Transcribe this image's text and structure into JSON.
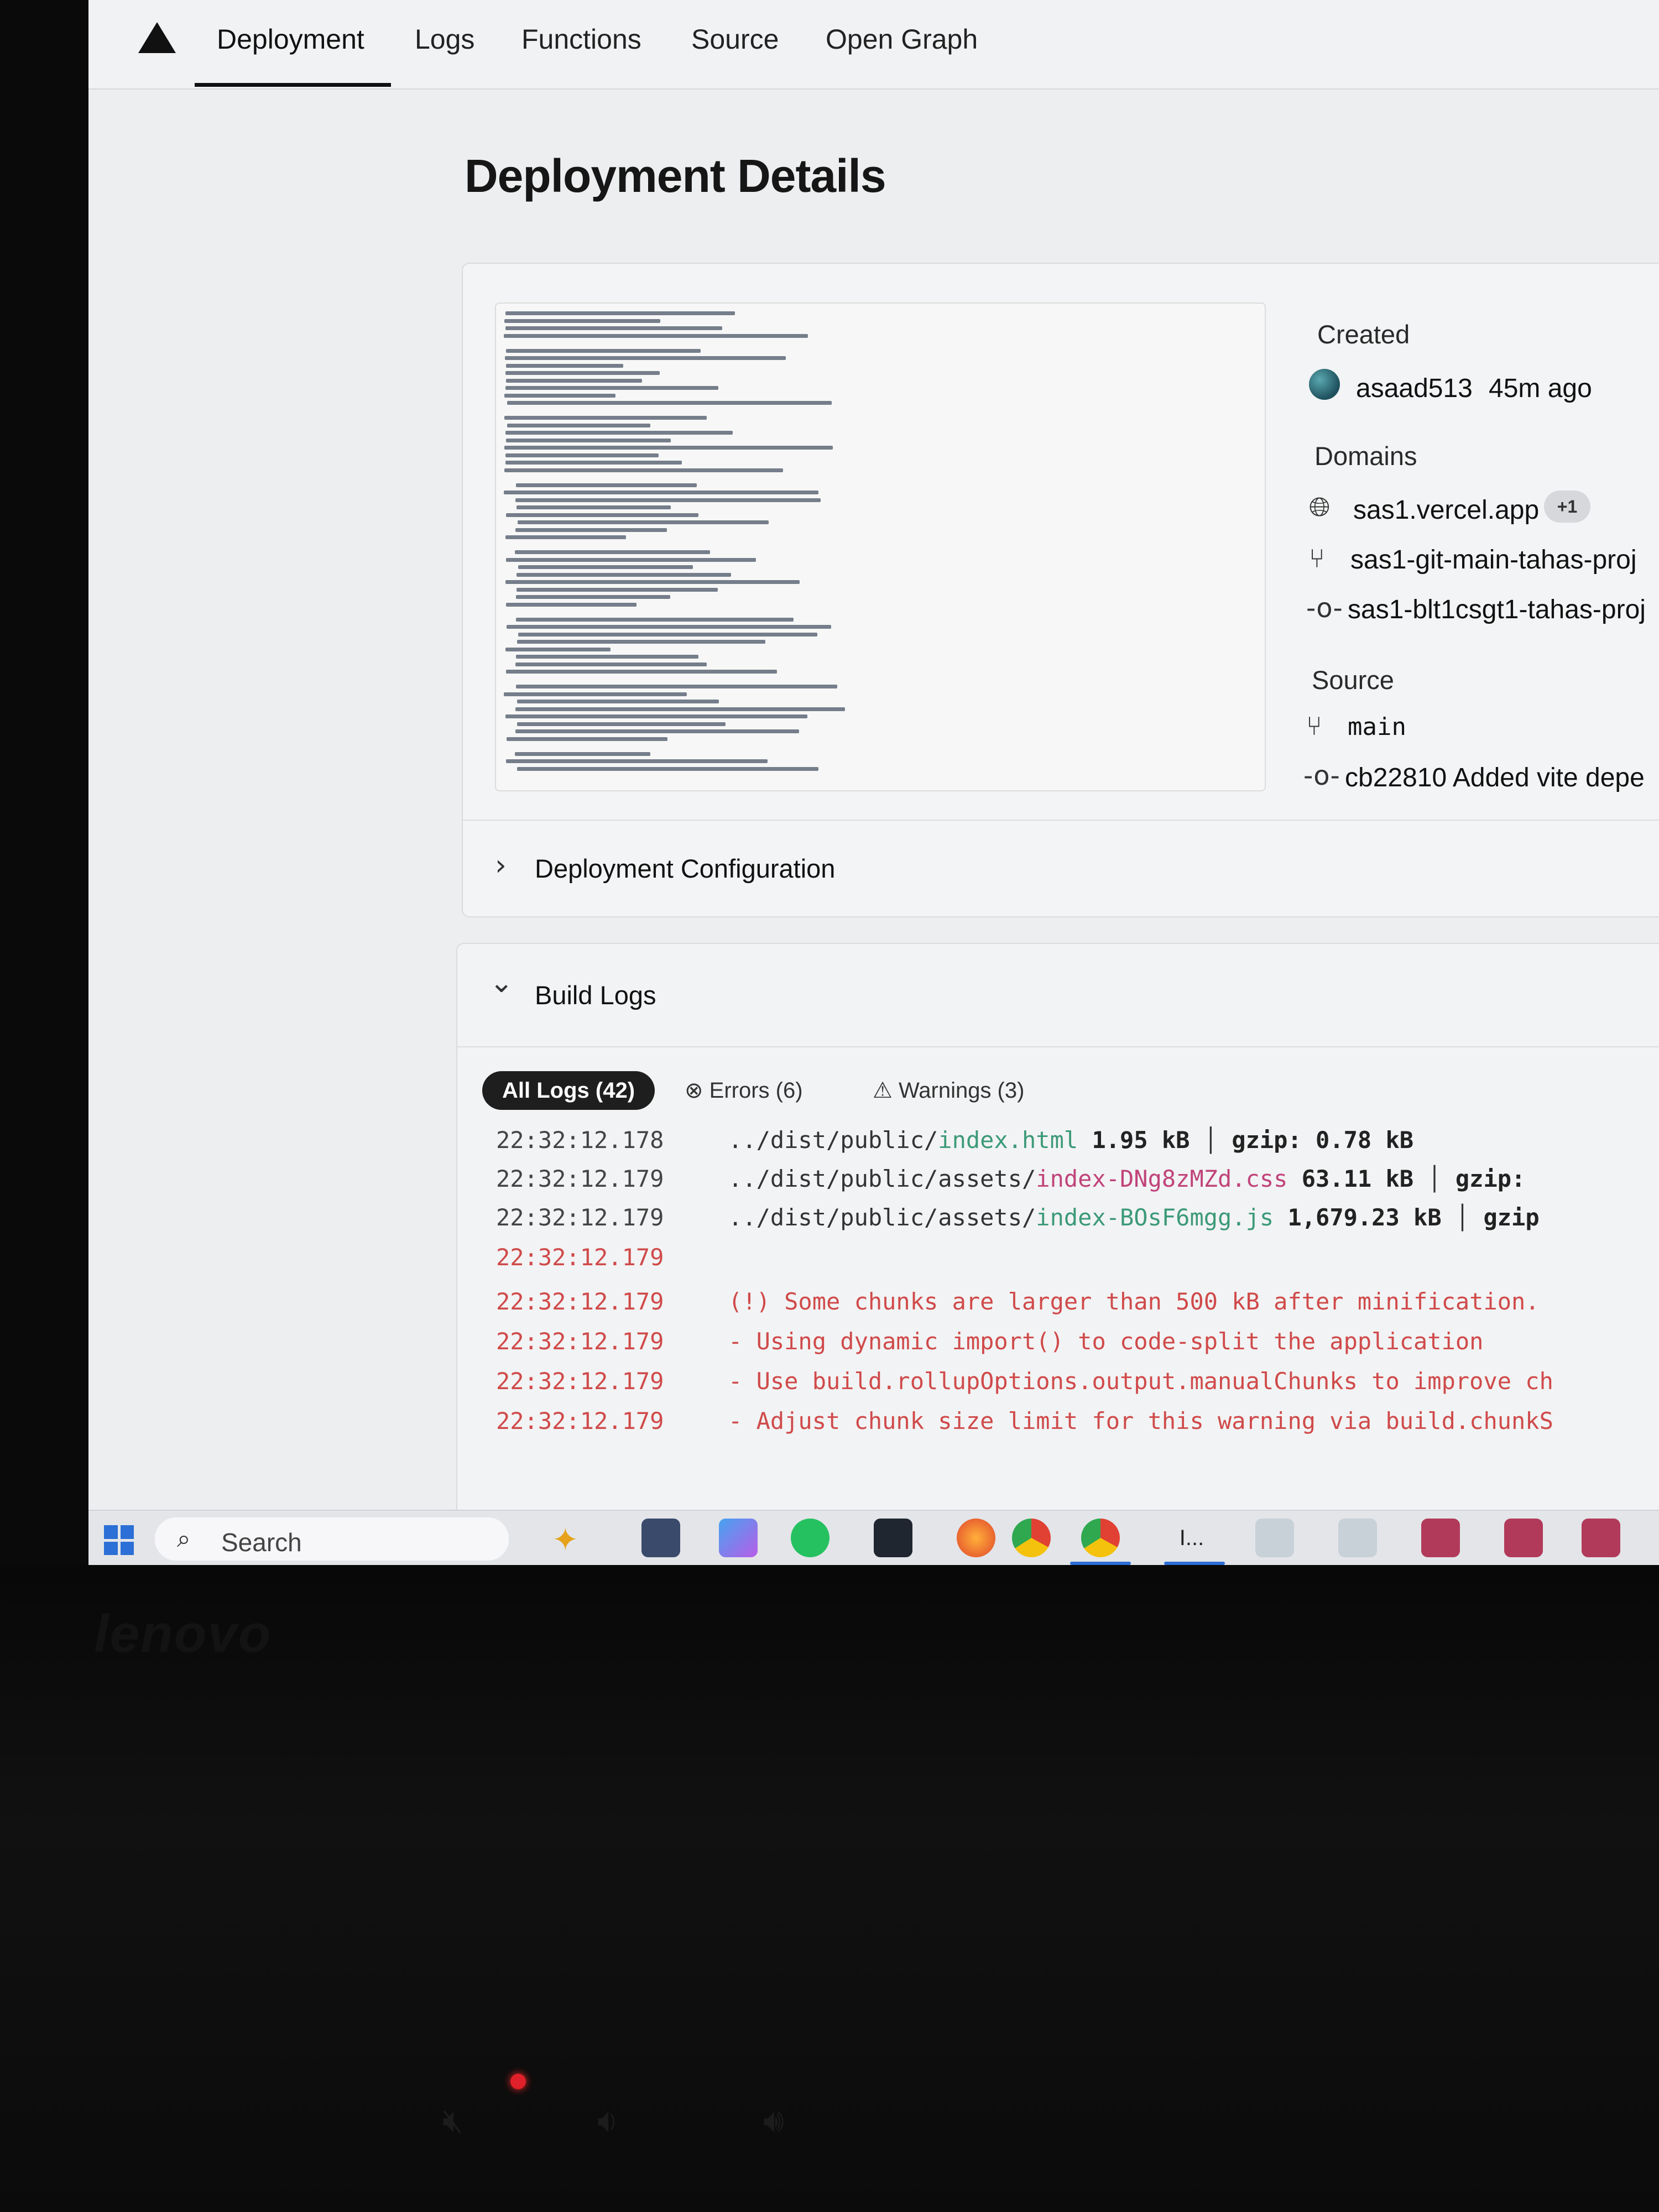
{
  "nav": {
    "tabs": [
      "Deployment",
      "Logs",
      "Functions",
      "Source",
      "Open Graph"
    ]
  },
  "page": {
    "title": "Deployment Details"
  },
  "details": {
    "created_label": "Created",
    "author": "asaad513",
    "created_ago": "45m ago",
    "domains_label": "Domains",
    "domains": [
      "sas1.vercel.app",
      "sas1-git-main-tahas-proj",
      "sas1-blt1csgt1-tahas-proj"
    ],
    "domains_extra": "+1",
    "source_label": "Source",
    "branch": "main",
    "commit": "cb22810 Added vite depe"
  },
  "config": {
    "label": "Deployment Configuration"
  },
  "build_logs": {
    "label": "Build Logs",
    "filters": {
      "all": "All Logs (42)",
      "errors": "Errors (6)",
      "warnings": "Warnings (3)"
    },
    "rows": [
      {
        "time": "22:32:12.178",
        "parts": [
          "../dist/public/",
          "index.html",
          " 1.95 kB",
          " │ ",
          "gzip: 0.78 kB"
        ]
      },
      {
        "time": "22:32:12.179",
        "parts": [
          "../dist/public/assets/",
          "index-DNg8zMZd.css",
          " 63.11 kB",
          " │ ",
          "gzip:"
        ]
      },
      {
        "time": "22:32:12.179",
        "parts": [
          "../dist/public/assets/",
          "index-BOsF6mgg.js",
          " 1,679.23 kB",
          " │ ",
          "gzip"
        ]
      },
      {
        "time": "22:32:12.179",
        "msg": ""
      },
      {
        "time": "22:32:12.179",
        "msg": "(!) Some chunks are larger than 500 kB after minification."
      },
      {
        "time": "22:32:12.179",
        "msg": "- Using dynamic import() to code-split the application"
      },
      {
        "time": "22:32:12.179",
        "msg": "- Use build.rollupOptions.output.manualChunks to improve ch"
      },
      {
        "time": "22:32:12.179",
        "msg": "- Adjust chunk size limit for this warning via build.chunkS"
      }
    ]
  },
  "taskbar": {
    "search_label": "Search"
  },
  "device": {
    "brand": "lenovo"
  },
  "colors": {
    "accent": "#2c6fd6",
    "error": "#d04a4a",
    "link_green": "#3c9a78",
    "link_pink": "#c0447a"
  }
}
